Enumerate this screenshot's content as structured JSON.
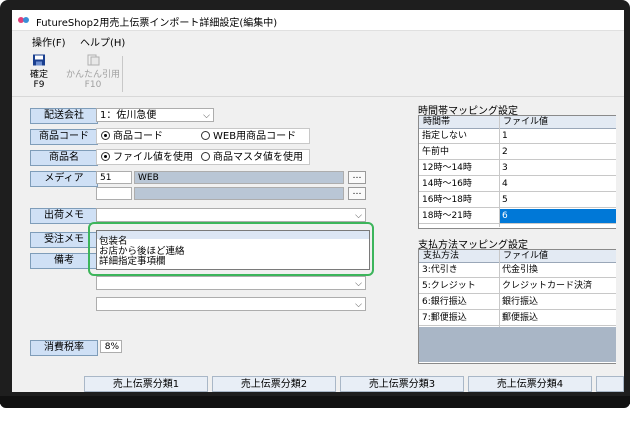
{
  "window": {
    "title": "FutureShop2用売上伝票インポート詳細設定(編集中)"
  },
  "menu": [
    {
      "label": "操作(F)"
    },
    {
      "label": "ヘルプ(H)"
    }
  ],
  "toolbar": {
    "confirm": {
      "label": "確定",
      "key": "F9",
      "icon": "save-icon"
    },
    "quote": {
      "label": "かんたん引用",
      "key": "F10",
      "icon": "quote-icon"
    }
  },
  "form": {
    "shipping_company": {
      "label": "配送会社",
      "value": "1：佐川急便"
    },
    "product_code": {
      "label": "商品コード",
      "options": [
        {
          "label": "商品コード",
          "selected": true
        },
        {
          "label": "WEB用商品コード",
          "selected": false
        }
      ]
    },
    "product_name": {
      "label": "商品名",
      "options": [
        {
          "label": "ファイル値を使用",
          "selected": true
        },
        {
          "label": "商品マスタ値を使用",
          "selected": false
        }
      ]
    },
    "media": {
      "label": "メディア",
      "code": "51",
      "name": "WEB",
      "code2": "",
      "name2": ""
    },
    "shipping_memo": {
      "label": "出荷メモ",
      "value": ""
    },
    "order_memo": {
      "label": "受注メモ"
    },
    "remarks": {
      "label": "備考"
    },
    "memo_options": [
      "",
      "包装名",
      "お店から後ほど連絡",
      "詳細指定事項欄"
    ],
    "tax_rate": {
      "label": "消費税率",
      "value": "8%"
    }
  },
  "time_mapping": {
    "title": "時間帯マッピング設定",
    "headers": [
      "時間帯",
      "ファイル値"
    ],
    "rows": [
      {
        "slot": "指定しない",
        "value": "1",
        "selected": false
      },
      {
        "slot": "午前中",
        "value": "2",
        "selected": false
      },
      {
        "slot": "12時～14時",
        "value": "3",
        "selected": false
      },
      {
        "slot": "14時～16時",
        "value": "4",
        "selected": false
      },
      {
        "slot": "16時～18時",
        "value": "5",
        "selected": false
      },
      {
        "slot": "18時～21時",
        "value": "6",
        "selected": true
      }
    ]
  },
  "payment_mapping": {
    "title": "支払方法マッピング設定",
    "headers": [
      "支払方法",
      "ファイル値"
    ],
    "rows": [
      {
        "method": "3:代引き",
        "value": "代金引換"
      },
      {
        "method": "5:クレジット",
        "value": "クレジットカード決済"
      },
      {
        "method": "6:銀行振込",
        "value": "銀行振込"
      },
      {
        "method": "7:郵便振込",
        "value": "郵便振込"
      }
    ]
  },
  "bottom_buttons": [
    {
      "label": "売上伝票分類1"
    },
    {
      "label": "売上伝票分類2"
    },
    {
      "label": "売上伝票分類3"
    },
    {
      "label": "売上伝票分類4"
    }
  ],
  "colors": {
    "accent": "#0078d7",
    "highlight_ring": "#3cb55b",
    "label_bg": "#cfe0f5"
  }
}
